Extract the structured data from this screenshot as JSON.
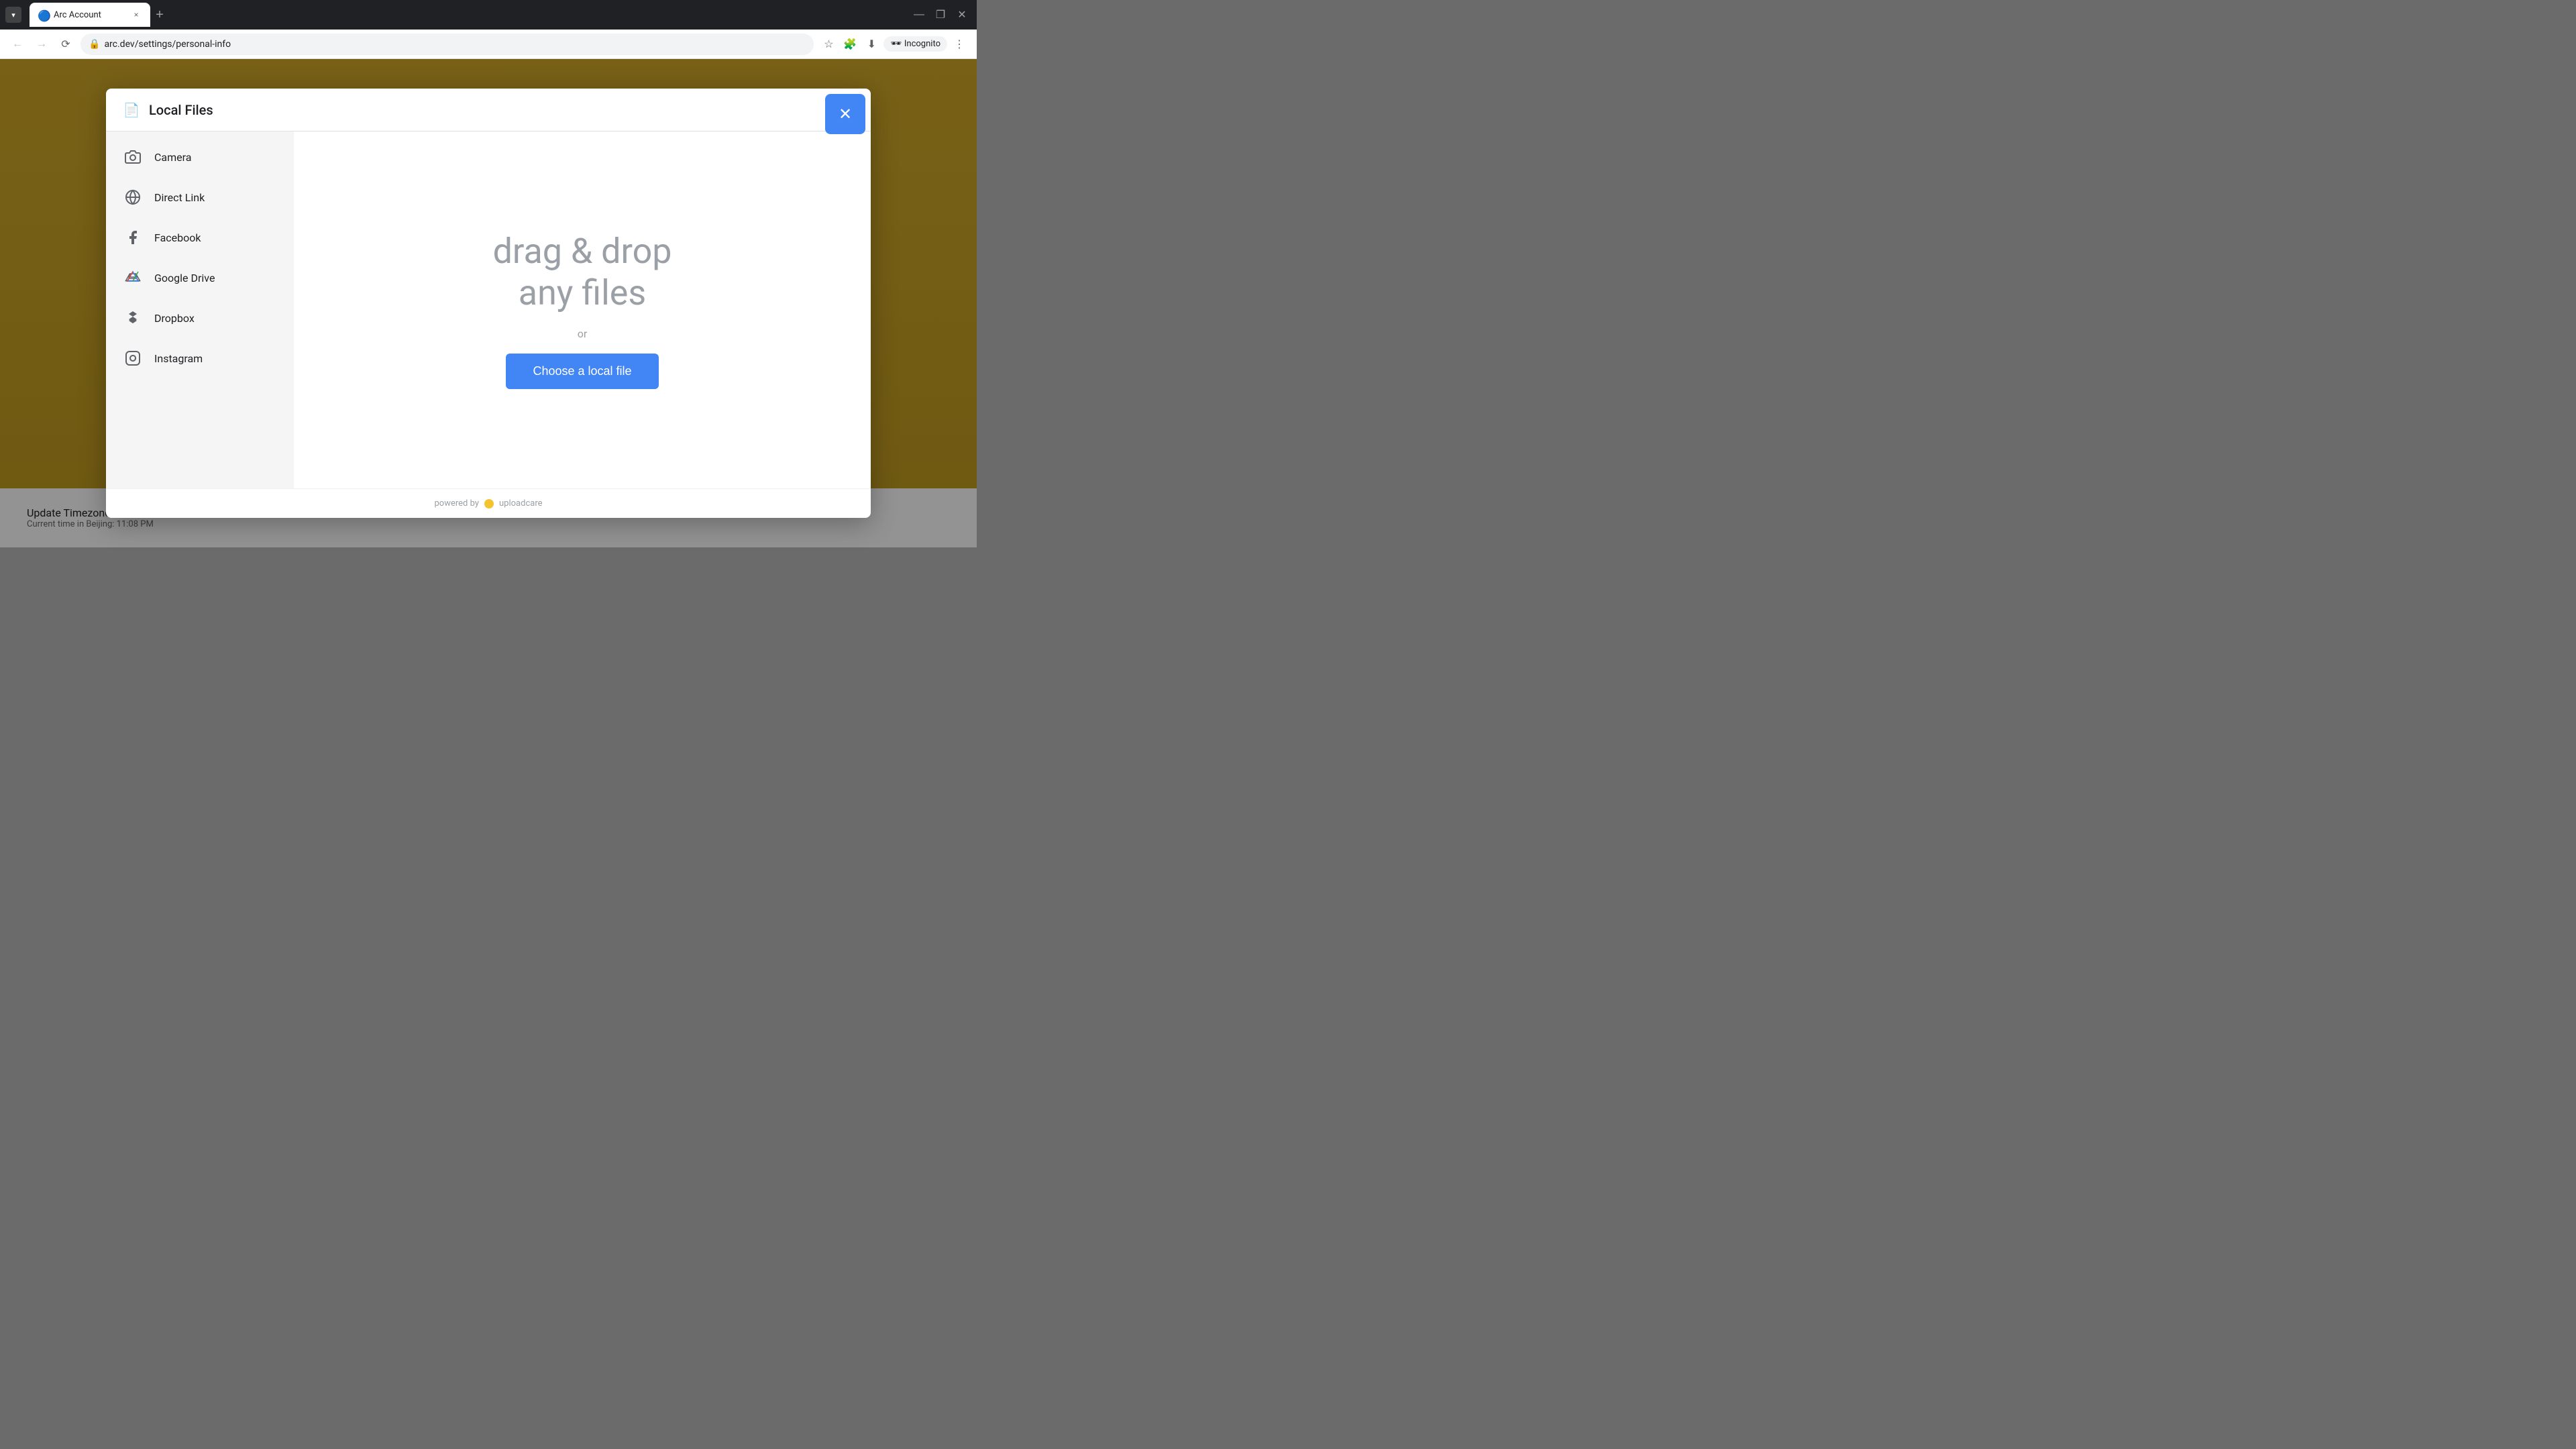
{
  "browser": {
    "tab": {
      "title": "Arc Account",
      "favicon": "🔵",
      "close_label": "×"
    },
    "new_tab_label": "+",
    "window_controls": {
      "minimize": "—",
      "maximize": "❐",
      "close": "✕"
    },
    "address_bar": {
      "url": "arc.dev/settings/personal-info",
      "back_title": "Back",
      "forward_title": "Forward",
      "refresh_title": "Refresh"
    },
    "toolbar": {
      "bookmark_title": "Bookmark",
      "extensions_title": "Extensions",
      "download_title": "Downloads",
      "incognito_label": "Incognito",
      "menu_title": "More"
    }
  },
  "modal": {
    "title": "Local Files",
    "title_icon": "📄",
    "close_label": "✕",
    "sidebar": {
      "items": [
        {
          "id": "camera",
          "label": "Camera",
          "icon": "camera"
        },
        {
          "id": "direct-link",
          "label": "Direct Link",
          "icon": "link"
        },
        {
          "id": "facebook",
          "label": "Facebook",
          "icon": "facebook"
        },
        {
          "id": "google-drive",
          "label": "Google Drive",
          "icon": "google-drive"
        },
        {
          "id": "dropbox",
          "label": "Dropbox",
          "icon": "dropbox"
        },
        {
          "id": "instagram",
          "label": "Instagram",
          "icon": "instagram"
        }
      ]
    },
    "main": {
      "drop_text_line1": "drag & drop",
      "drop_text_line2": "any files",
      "or_text": "or",
      "choose_file_label": "Choose a local file"
    },
    "footer": {
      "powered_by_prefix": "powered by",
      "brand_name": "uploadcare"
    }
  },
  "page": {
    "update_timezone_label": "Update Timezone",
    "current_time_label": "Current time in Beijing: 11:08 PM"
  },
  "colors": {
    "accent_blue": "#4285f4",
    "sidebar_bg": "#f5f5f5",
    "modal_bg": "#ffffff",
    "drop_text_color": "#9aa0a6",
    "uploadcare_yellow": "#f4c430"
  }
}
